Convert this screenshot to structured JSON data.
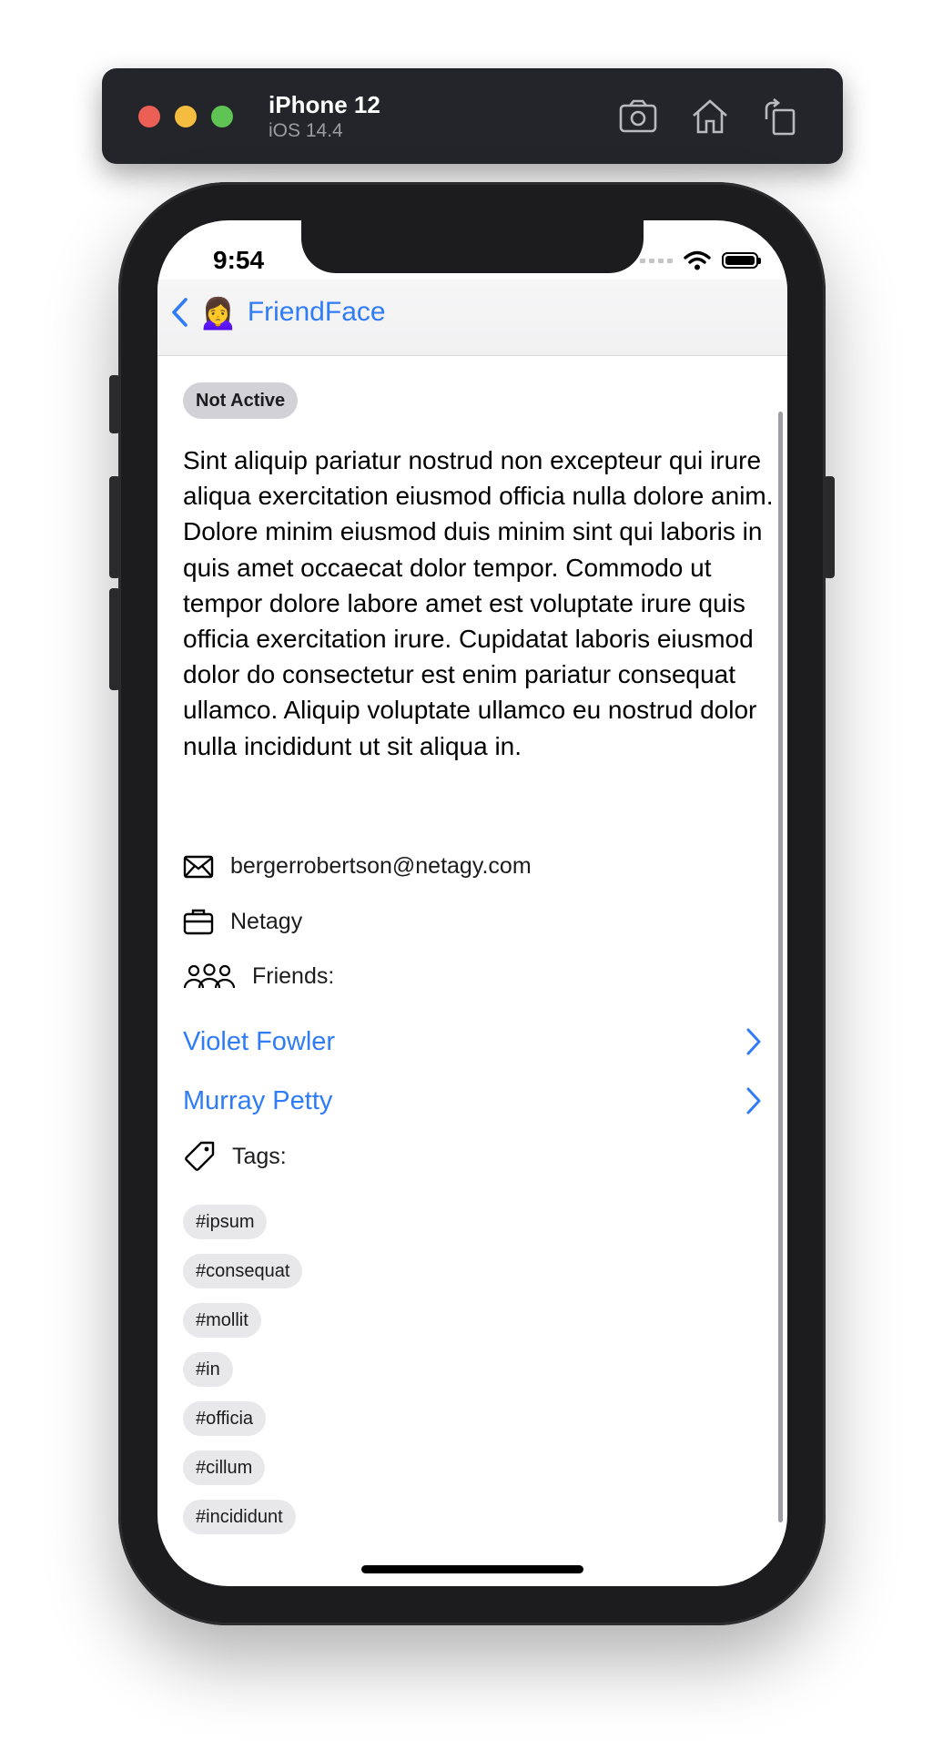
{
  "simulator": {
    "device_name": "iPhone 12",
    "os_version": "iOS 14.4",
    "buttons": [
      "screenshot-icon",
      "home-icon",
      "rotate-icon"
    ]
  },
  "status_bar": {
    "time": "9:54"
  },
  "nav": {
    "back_emoji": "🙍‍♀️",
    "back_title": "FriendFace"
  },
  "user": {
    "status": "Not Active",
    "about": "Sint aliquip pariatur nostrud non excepteur qui irure aliqua exercitation eiusmod officia nulla dolore anim. Dolore minim eiusmod duis minim sint qui laboris in quis amet occaecat dolor tempor. Commodo ut tempor dolore labore amet est voluptate irure quis officia exercitation irure. Cupidatat laboris eiusmod dolor do consectetur est enim pariatur consequat ullamco. Aliquip voluptate ullamco eu nostrud dolor nulla incididunt ut sit aliqua in.",
    "email": "bergerrobertson@netagy.com",
    "company": "Netagy",
    "friends_label": "Friends:",
    "friends": [
      "Violet Fowler",
      "Murray Petty"
    ],
    "tags_label": "Tags:",
    "tags": [
      "#ipsum",
      "#consequat",
      "#mollit",
      "#in",
      "#officia",
      "#cillum",
      "#incididunt"
    ]
  },
  "colors": {
    "accent": "#2f7cf6",
    "pill": "#d1d1d6",
    "tag": "#e8e8ea",
    "toolbar": "#23252a"
  }
}
